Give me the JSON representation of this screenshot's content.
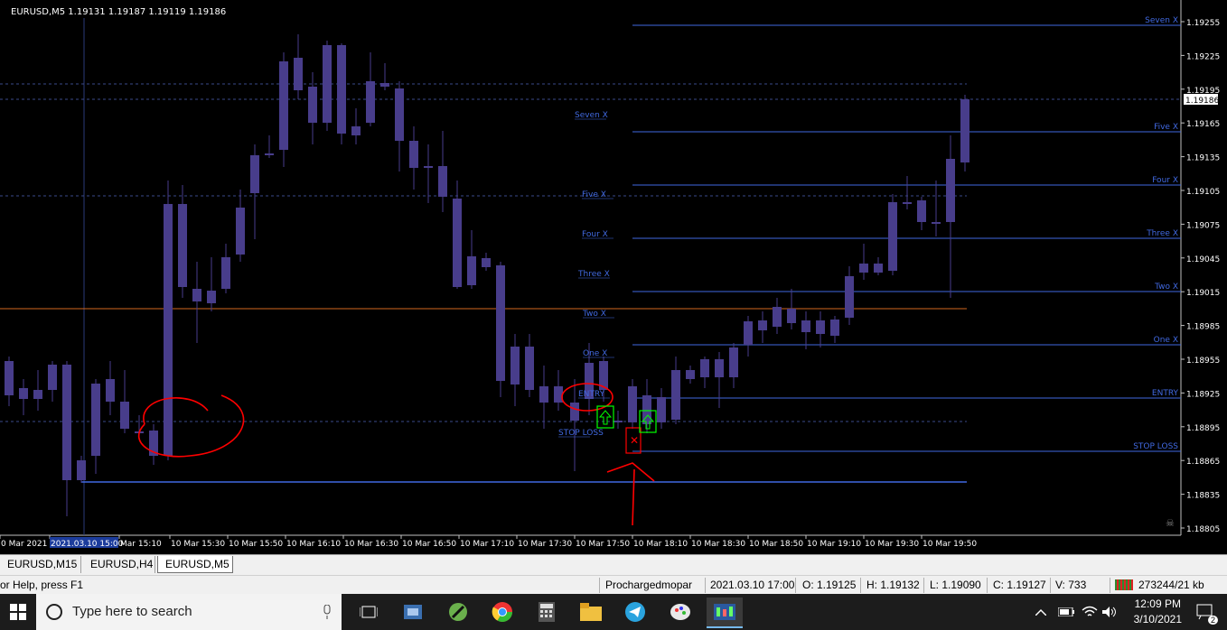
{
  "chart": {
    "header": "EURUSD,M5  1.19131 1.19187 1.19119 1.19186",
    "price_ticks": [
      "1.19255",
      "1.19225",
      "1.19195",
      "1.19165",
      "1.19135",
      "1.19105",
      "1.19075",
      "1.19045",
      "1.19015",
      "1.18985",
      "1.18955",
      "1.18925",
      "1.18895",
      "1.18865",
      "1.18835",
      "1.18805"
    ],
    "current_price": "1.19186",
    "time_ticks": [
      "0 Mar 2021",
      "2021.03.10 15:00",
      "Mar 15:10",
      "10 Mar 15:30",
      "10 Mar 15:50",
      "10 Mar 16:10",
      "10 Mar 16:30",
      "10 Mar 16:50",
      "10 Mar 17:10",
      "10 Mar 17:30",
      "10 Mar 17:50",
      "10 Mar 18:10",
      "10 Mar 18:30",
      "10 Mar 18:50",
      "10 Mar 19:10",
      "10 Mar 19:30",
      "10 Mar 19:50"
    ],
    "left_level_labels": [
      "Seven X",
      "Five X",
      "Four X",
      "Three X",
      "Two X",
      "One X",
      "ENTRY",
      "STOP LOSS"
    ],
    "right_level_labels": [
      "Seven X",
      "Five X",
      "Four X",
      "Three X",
      "Two X",
      "One X",
      "ENTRY",
      "STOP LOSS"
    ],
    "colors": {
      "bull": "#9370DB",
      "bear": "#483D8B",
      "level": "#4169E1",
      "orange": "#D2691E",
      "annotation": "#FF0000",
      "arrow": "#00FF00"
    }
  },
  "tabs": [
    "EURUSD,M15",
    "EURUSD,H4",
    "EURUSD,M5"
  ],
  "active_tab": "EURUSD,M5",
  "status": {
    "help": "or Help, press F1",
    "profile": "Prochargedmopar",
    "datetime": "2021.03.10 17:00",
    "open": "O: 1.19125",
    "high": "H: 1.19132",
    "low": "L: 1.19090",
    "close": "C: 1.19127",
    "volume": "V: 733",
    "traffic": "273244/21 kb"
  },
  "taskbar": {
    "search_placeholder": "Type here to search",
    "time": "12:09 PM",
    "date": "3/10/2021",
    "notification_count": "2",
    "icons": [
      "windows-start-icon",
      "cortana-circle-icon",
      "microphone-icon",
      "task-view-icon",
      "app-icon-1",
      "app-icon-2",
      "chrome-icon",
      "calculator-icon",
      "file-explorer-icon",
      "telegram-icon",
      "paint-icon",
      "mt4-icon"
    ]
  }
}
